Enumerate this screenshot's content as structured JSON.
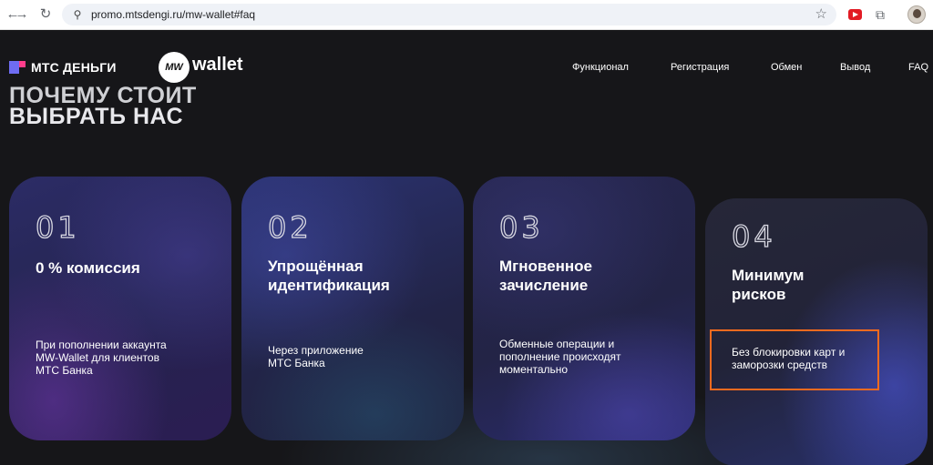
{
  "browser": {
    "back_icon": "←",
    "forward_icon": "→",
    "reload_icon": "↻",
    "site_settings_icon": "⚲",
    "url": "promo.mtsdengi.ru/mw-wallet#faq",
    "star_icon": "☆",
    "puzzle_icon": "⧉"
  },
  "header": {
    "brand": "МТС ДЕНЬГИ",
    "mw_badge": "MW",
    "mw_word": "wallet",
    "nav": [
      "Функционал",
      "Регистрация",
      "Обмен",
      "Вывод",
      "FAQ"
    ]
  },
  "headline": [
    "ПОЧЕМУ СТОИТ",
    "ВЫБРАТЬ НАС"
  ],
  "cards": [
    {
      "num": "01",
      "title": "0 % комиссия",
      "desc": "При пополнении аккаунта MW-Wallet для клиентов МТС Банка"
    },
    {
      "num": "02",
      "title": "Упрощённая идентификация",
      "desc": "Через приложение МТС Банка"
    },
    {
      "num": "03",
      "title": "Мгновенное зачисление",
      "desc": "Обменные операции и пополнение происходят моментально"
    },
    {
      "num": "04",
      "title": "Минимум рисков",
      "desc": "Без блокировки карт и заморозки средств"
    }
  ],
  "colors": {
    "page_bg": "#161619",
    "highlight": "#f26a1f",
    "mts_violet": "#6e6cf2",
    "mts_pink": "#ff3d8b"
  }
}
